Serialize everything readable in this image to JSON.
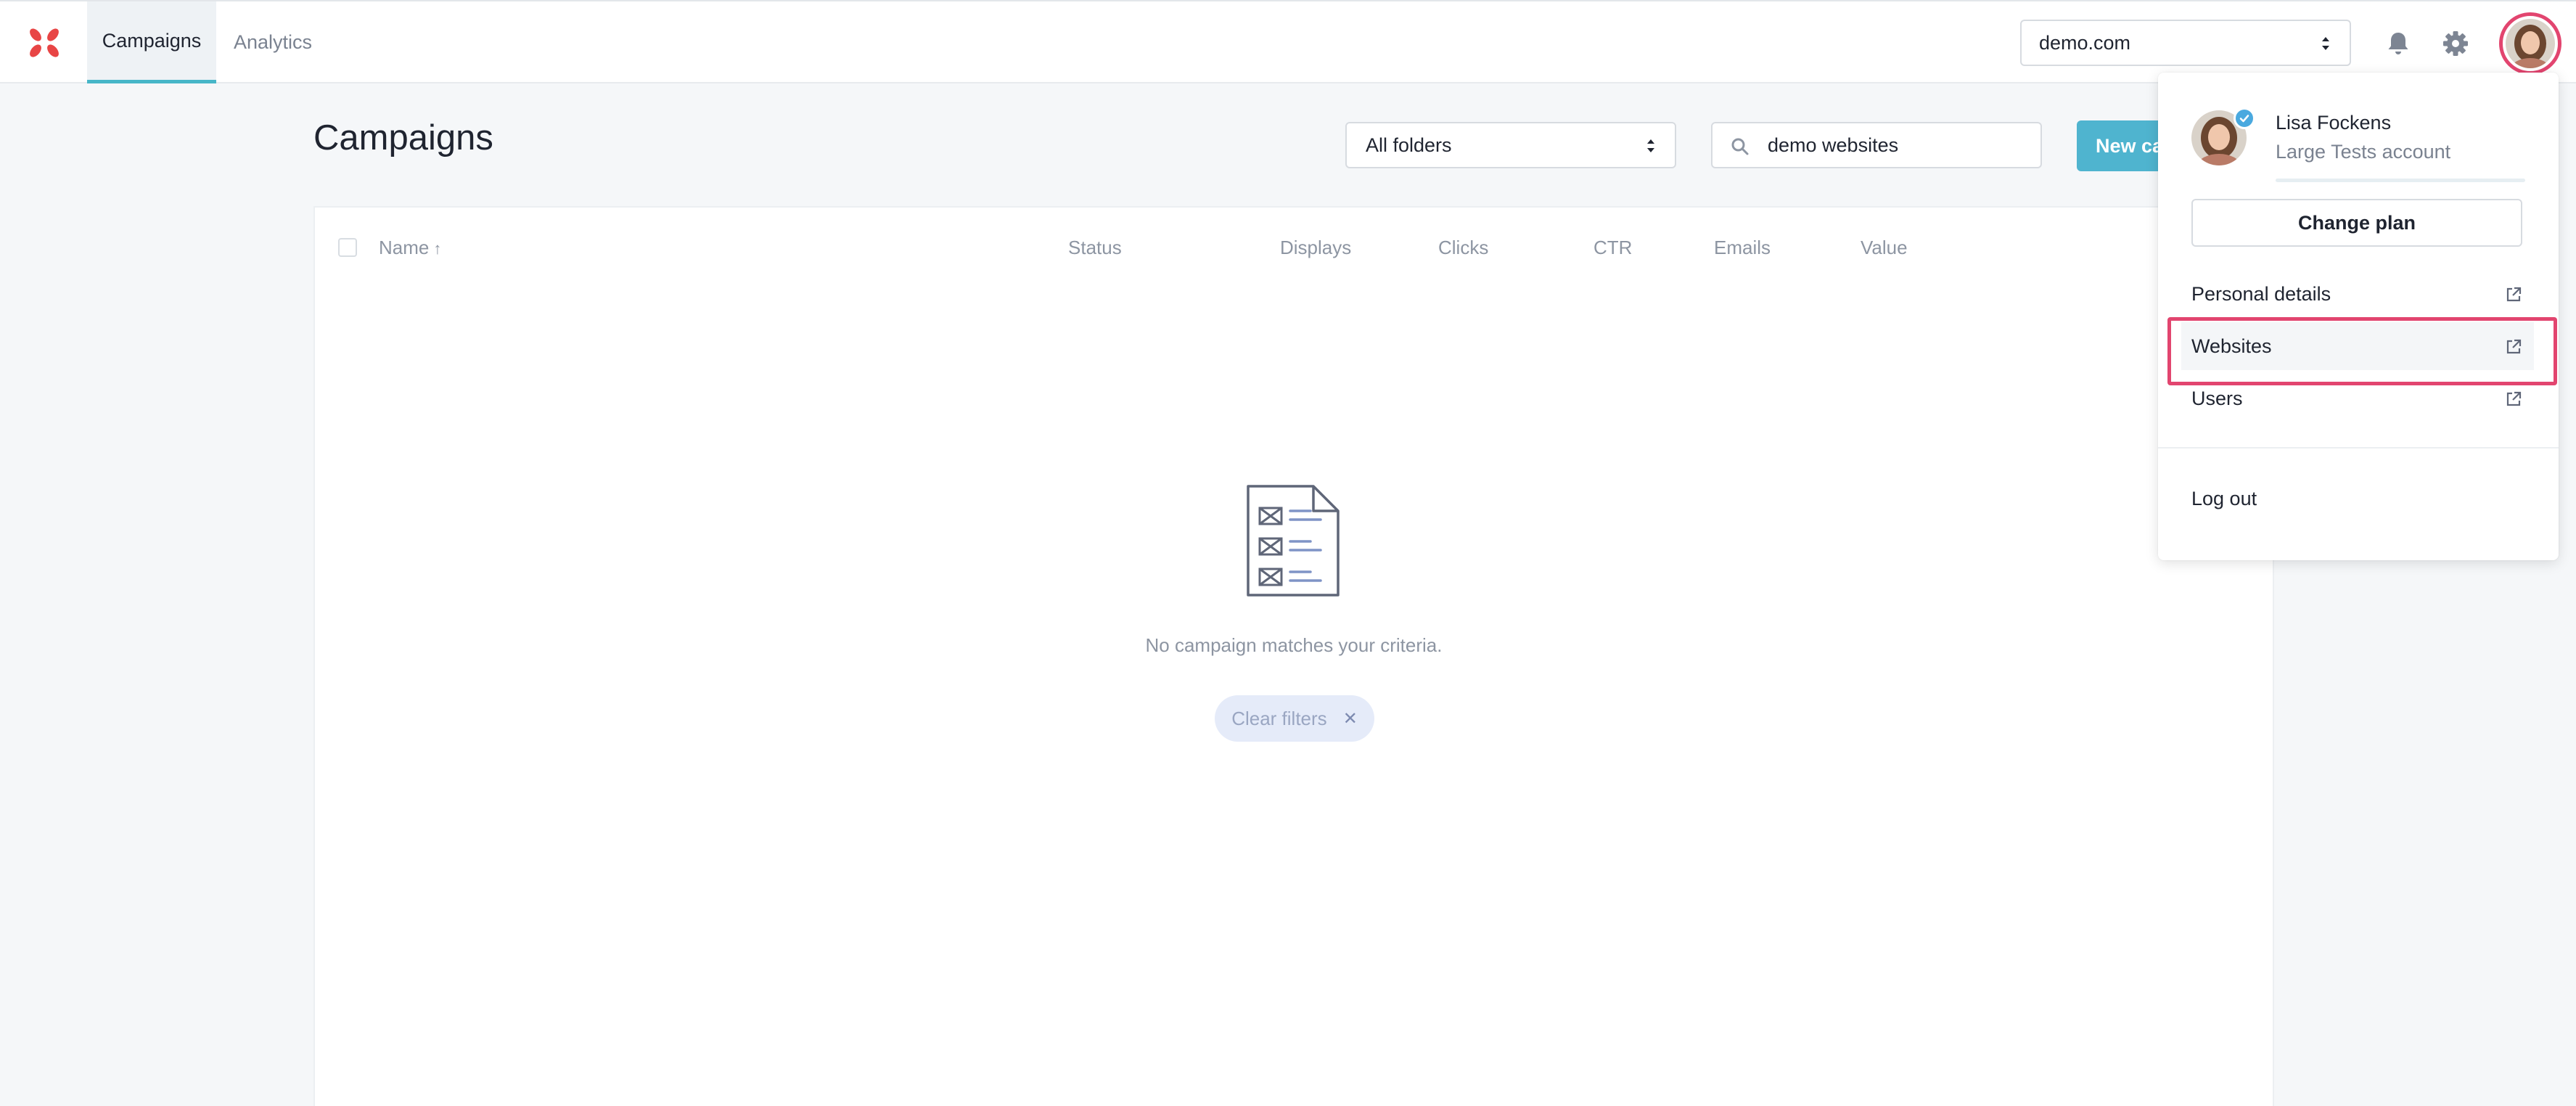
{
  "nav": {
    "tabs": [
      {
        "label": "Campaigns",
        "active": true
      },
      {
        "label": "Analytics",
        "active": false
      }
    ],
    "site_select": {
      "value": "demo.com"
    }
  },
  "main": {
    "title": "Campaigns",
    "folder_select": {
      "value": "All folders"
    },
    "search": {
      "value": "demo websites"
    },
    "new_campaign_label": "New campaign",
    "table": {
      "columns": [
        "Name",
        "Status",
        "Displays",
        "Clicks",
        "CTR",
        "Emails",
        "Value"
      ],
      "rows": []
    },
    "empty_state": {
      "message": "No campaign matches your criteria.",
      "clear_filters_label": "Clear filters"
    }
  },
  "account_menu": {
    "user_name": "Lisa Fockens",
    "account_name": "Large Tests account",
    "change_plan_label": "Change plan",
    "items": [
      {
        "label": "Personal details",
        "icon": "external-link-icon"
      },
      {
        "label": "Websites",
        "icon": "external-link-icon",
        "highlighted": true
      },
      {
        "label": "Users",
        "icon": "external-link-icon"
      }
    ],
    "logout_label": "Log out"
  },
  "colors": {
    "accent": "#47b6c8",
    "primary_button": "#4fb4cf",
    "highlight": "#e2456f",
    "logo": "#e84545"
  }
}
